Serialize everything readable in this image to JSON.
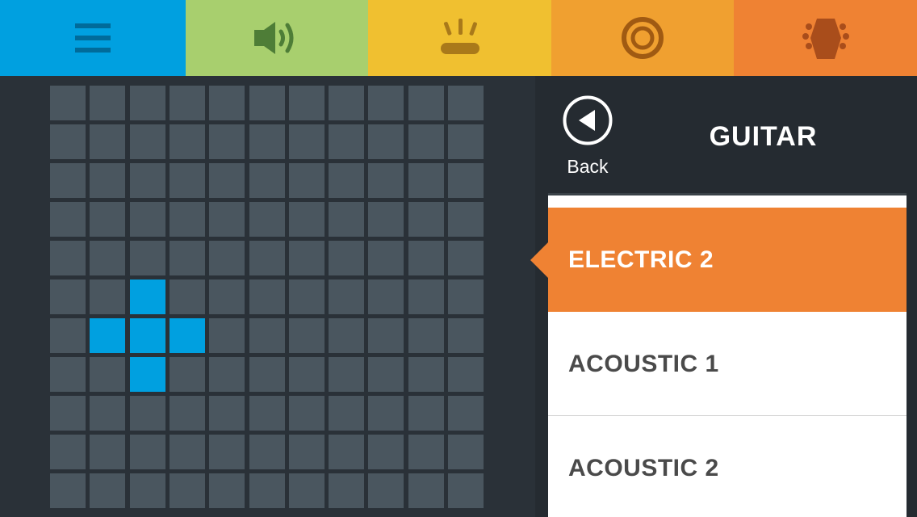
{
  "tabs": [
    {
      "id": "menu",
      "icon": "menu-icon",
      "color": "#00a0e0",
      "icon_color": "#006b9a"
    },
    {
      "id": "sound",
      "icon": "speaker-icon",
      "color": "#a8cf6e",
      "icon_color": "#4e7d37"
    },
    {
      "id": "drums",
      "icon": "drum-icon",
      "color": "#f0c030",
      "icon_color": "#a9791a"
    },
    {
      "id": "target",
      "icon": "target-icon",
      "color": "#f0a030",
      "icon_color": "#a05a12"
    },
    {
      "id": "guitar",
      "icon": "guitar-headstock-icon",
      "color": "#ef8233",
      "icon_color": "#a94d1b",
      "active": true
    }
  ],
  "grid": {
    "rows": 11,
    "cols": 11,
    "cell_color": "#4a565f",
    "active_color": "#00a0e0",
    "active_cells": [
      [
        5,
        2
      ],
      [
        6,
        1
      ],
      [
        6,
        2
      ],
      [
        6,
        3
      ],
      [
        7,
        2
      ]
    ]
  },
  "side": {
    "back_label": "Back",
    "title": "GUITAR"
  },
  "instruments": [
    {
      "label": "ELECTRIC 2",
      "selected": true
    },
    {
      "label": "ACOUSTIC 1",
      "selected": false
    },
    {
      "label": "ACOUSTIC 2",
      "selected": false
    }
  ]
}
